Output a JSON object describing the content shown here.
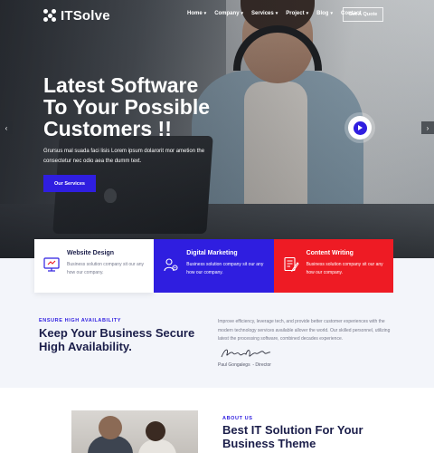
{
  "brand": {
    "name": "ITSolve"
  },
  "nav": {
    "items": [
      {
        "label": "Home",
        "has_dropdown": true
      },
      {
        "label": "Company",
        "has_dropdown": true
      },
      {
        "label": "Services",
        "has_dropdown": true
      },
      {
        "label": "Project",
        "has_dropdown": true
      },
      {
        "label": "Blog",
        "has_dropdown": true
      },
      {
        "label": "Contact",
        "has_dropdown": false
      }
    ],
    "cta_label": "Get A Quote"
  },
  "hero": {
    "title": "Latest Software To Your Possible Customers !!",
    "description": "Grursus mal suada faci lisis Lorem ipsum dolarorit mor ametion the consectetur nec odio aea the dumm text.",
    "button_label": "Our Services",
    "prev_icon": "chevron-left-icon",
    "next_icon": "chevron-right-icon",
    "play_icon": "play-icon"
  },
  "services": [
    {
      "title": "Website Design",
      "description": "Business solution company sit our any how our company.",
      "icon": "monitor-icon",
      "style": "white"
    },
    {
      "title": "Digital Marketing",
      "description": "Business solution company sit our any how our company.",
      "icon": "gear-user-icon",
      "style": "blue"
    },
    {
      "title": "Content Writing",
      "description": "Business solution company sit our any how our company.",
      "icon": "document-pen-icon",
      "style": "red"
    }
  ],
  "availability": {
    "kicker": "ENSURE HIGH AVAILABILITY",
    "title": "Keep Your Business Secure High Availability.",
    "text": "Improve efficiency, leverage tech, and provide better customer experiences with the modern technology services available allover the world. Our skilled personnel, utilizing latest the processing software, combined decades experience.",
    "signature_name": "Paul Gongalegs",
    "signature_role": "- Director"
  },
  "about": {
    "kicker": "ABOUT US",
    "title": "Best IT Solution For Your Business Theme"
  },
  "colors": {
    "primary": "#2f1ee0",
    "accent": "#ee1b24",
    "heading": "#1b1e4a"
  }
}
